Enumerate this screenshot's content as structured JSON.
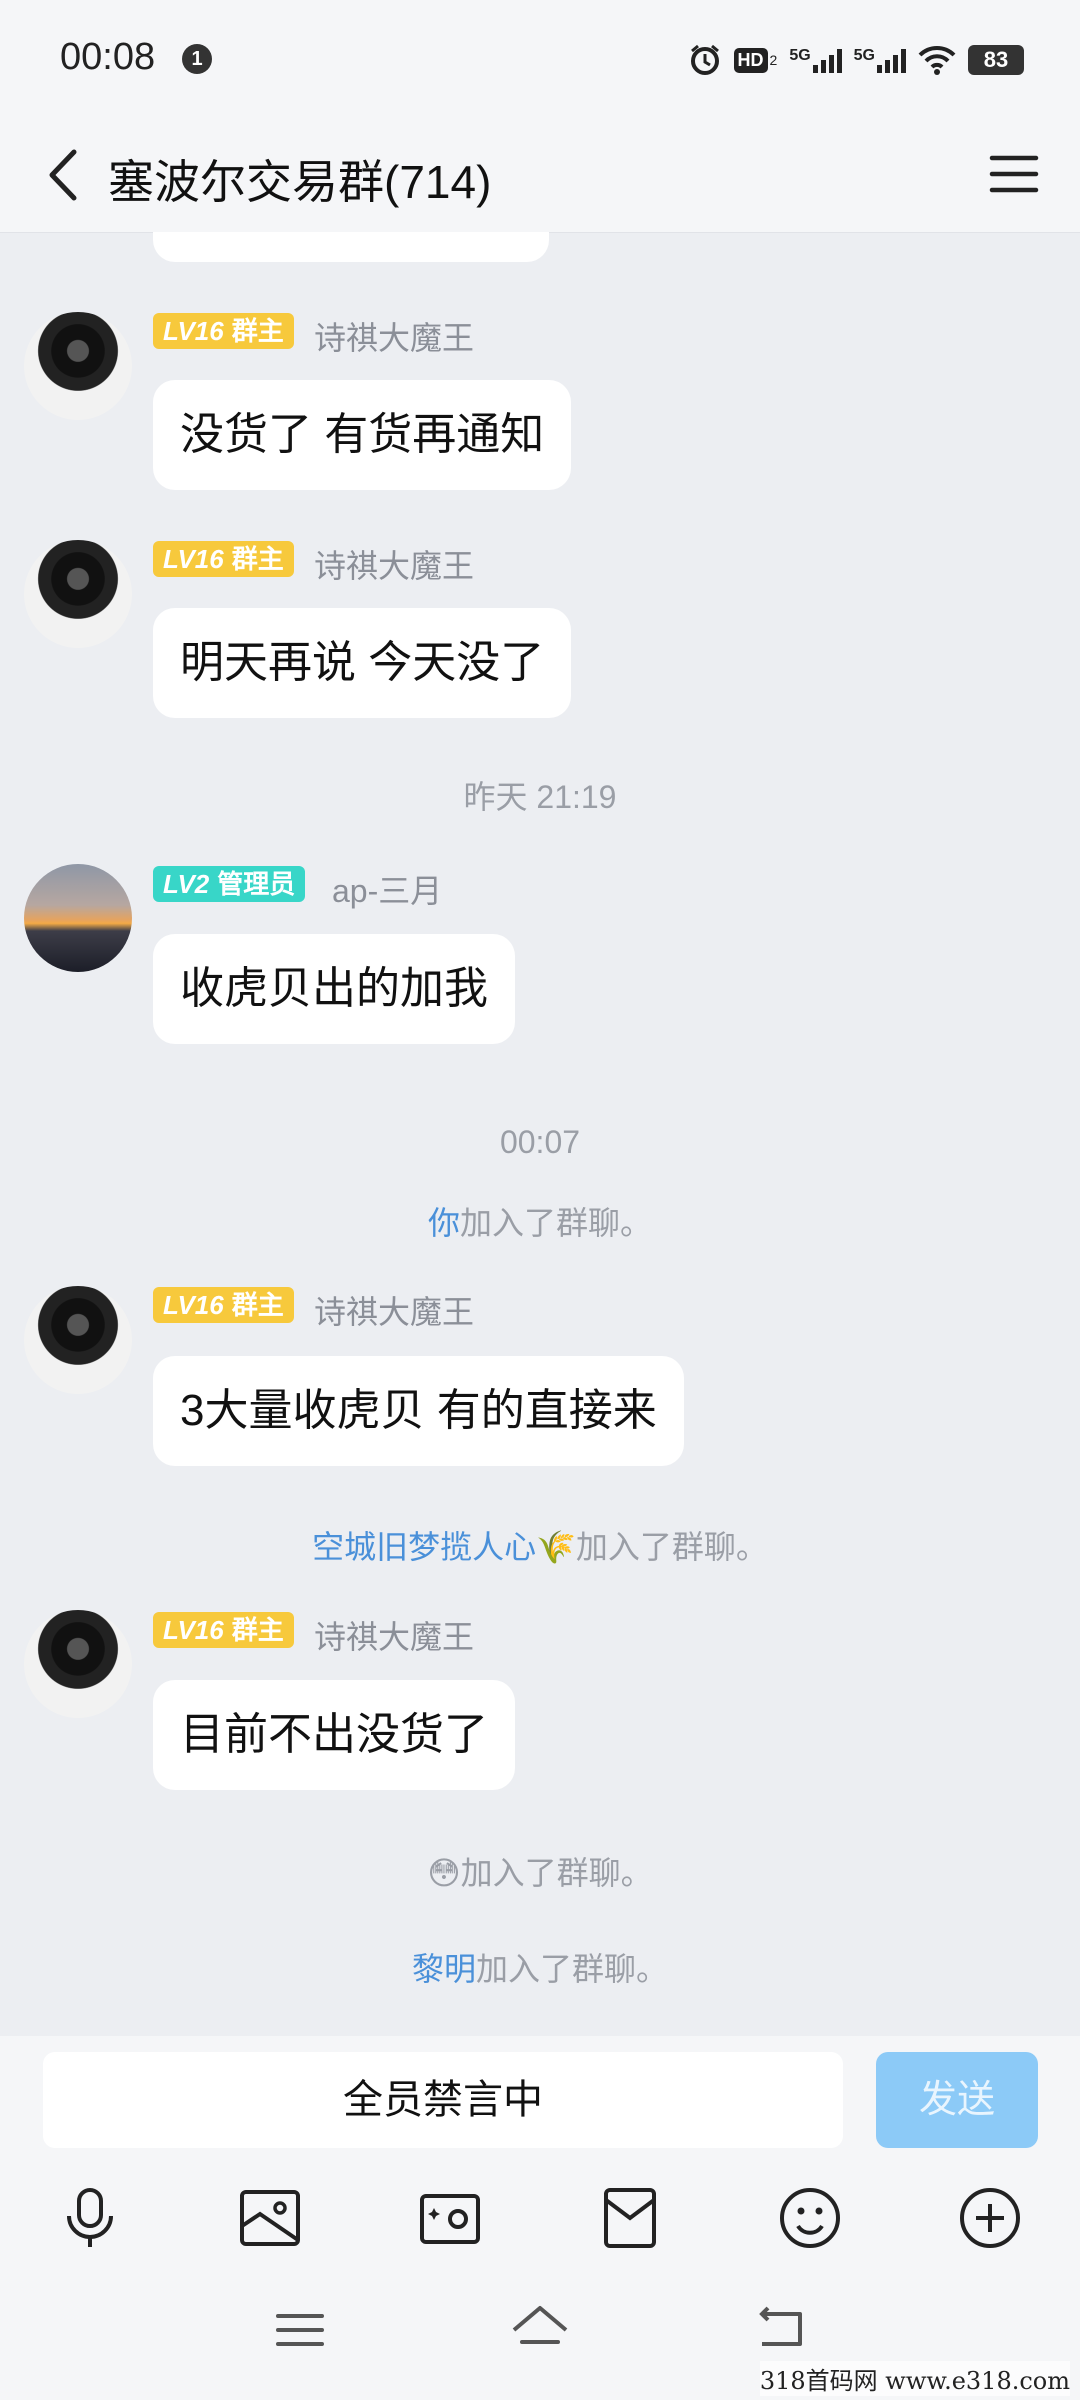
{
  "status_bar": {
    "time": "00:08",
    "notification_count": "1",
    "hd": "HD",
    "hd_sub": "2",
    "net1": "5G",
    "net2": "5G",
    "battery": "83"
  },
  "header": {
    "title": "塞波尔交易群(714)"
  },
  "messages": [
    {
      "level": "LV16",
      "role": "群主",
      "sender": "诗祺大魔王",
      "text": "没货了 有货再通知"
    },
    {
      "level": "LV16",
      "role": "群主",
      "sender": "诗祺大魔王",
      "text": "明天再说  今天没了"
    },
    {
      "level": "LV2",
      "role": "管理员",
      "sender": "ap-三月",
      "text": "收虎贝出的加我"
    },
    {
      "level": "LV16",
      "role": "群主",
      "sender": "诗祺大魔王",
      "text": "3大量收虎贝  有的直接来"
    },
    {
      "level": "LV16",
      "role": "群主",
      "sender": "诗祺大魔王",
      "text": "目前不出没货了"
    }
  ],
  "timestamps": [
    "昨天 21:19",
    "00:07"
  ],
  "system_events": [
    {
      "name": "你",
      "suffix": "加入了群聊。"
    },
    {
      "name": "空城旧梦揽人心🌾",
      "suffix": "加入了群聊。"
    },
    {
      "name": "😳",
      "suffix": "加入了群聊。"
    },
    {
      "name": "黎明",
      "suffix": "加入了群聊。"
    }
  ],
  "input": {
    "mute_text": "全员禁言中",
    "send_label": "发送"
  },
  "watermark": "318首码网  www.e318.com",
  "colors": {
    "owner_badge": "#f7c93c",
    "admin_badge": "#38d6c8",
    "link": "#4a90d9",
    "send_button": "#8ccaf7"
  }
}
